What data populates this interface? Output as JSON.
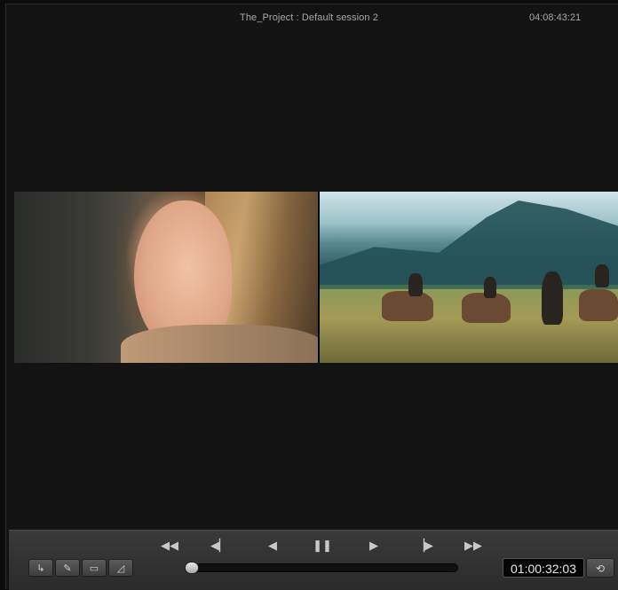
{
  "header": {
    "title": "The_Project : Default session 2",
    "timecode": "04:08:43:21"
  },
  "transport": {
    "buttons": [
      {
        "name": "rewind",
        "glyph": "◀◀"
      },
      {
        "name": "step-back",
        "glyph": "◀▏"
      },
      {
        "name": "play-reverse",
        "glyph": "◀"
      },
      {
        "name": "pause",
        "glyph": "❚❚"
      },
      {
        "name": "play",
        "glyph": "▶"
      },
      {
        "name": "step-forward",
        "glyph": "▕▶"
      },
      {
        "name": "fast-forward",
        "glyph": "▶▶"
      }
    ]
  },
  "tools": [
    {
      "name": "reverse-arrow-icon",
      "glyph": "↳"
    },
    {
      "name": "pen-icon",
      "glyph": "✎"
    },
    {
      "name": "monitor-icon",
      "glyph": "▭"
    },
    {
      "name": "brush-icon",
      "glyph": "◿"
    }
  ],
  "scrubber": {
    "position_fraction": 0.0
  },
  "footer": {
    "timecode": "01:00:32:03",
    "loop_glyph": "⟲"
  }
}
